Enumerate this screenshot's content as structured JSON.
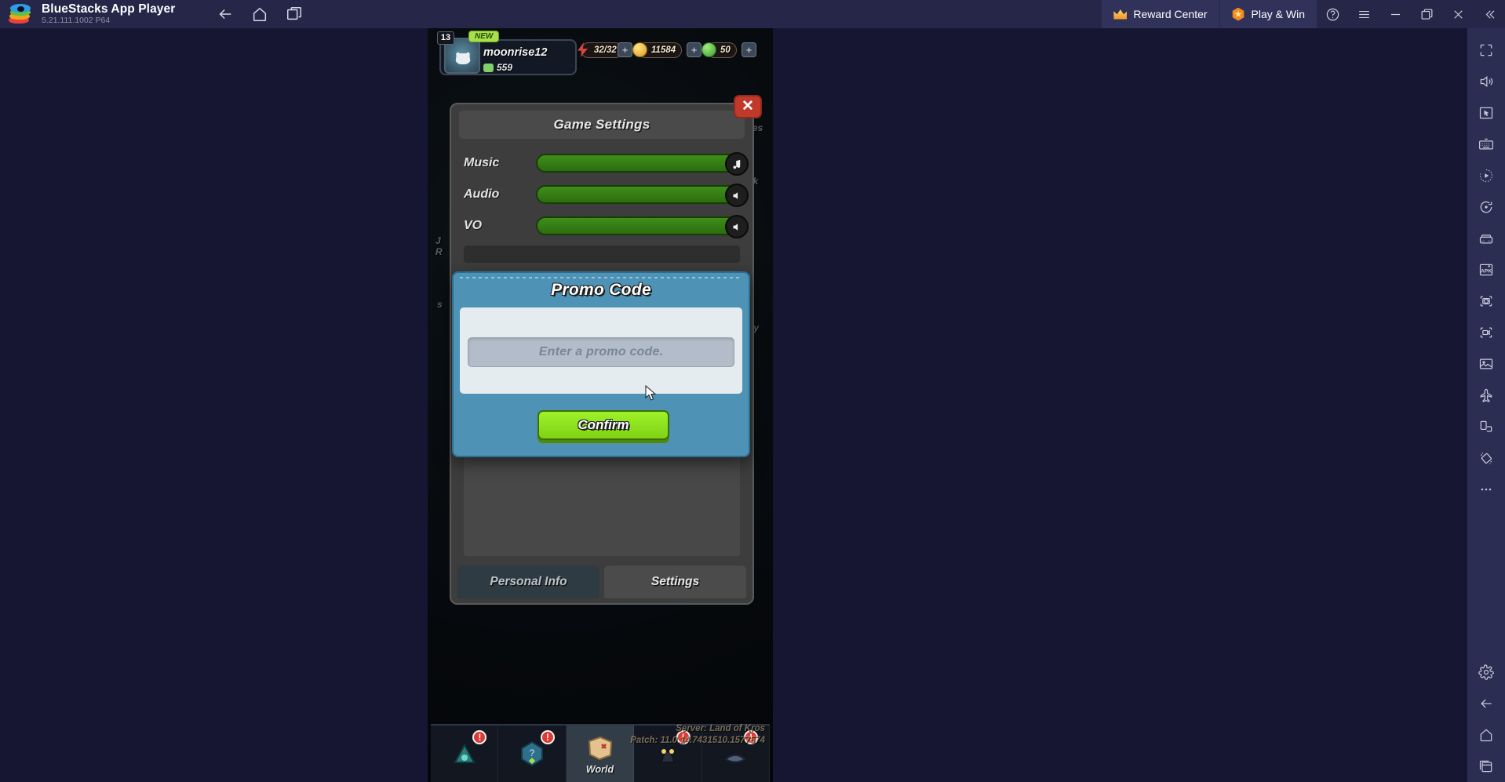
{
  "titlebar": {
    "app_name": "BlueStacks App Player",
    "version": "5.21.111.1002  P64",
    "logo_icon": "bluestacks-logo",
    "nav": [
      {
        "name": "back",
        "icon": "arrow-left-icon"
      },
      {
        "name": "home",
        "icon": "home-icon"
      },
      {
        "name": "multi-instance",
        "icon": "window-stack-icon"
      }
    ],
    "reward_center": {
      "label": "Reward Center",
      "icon": "crown-icon"
    },
    "play_and_win": {
      "label": "Play & Win",
      "icon": "hex-star-icon"
    },
    "window_buttons": [
      {
        "name": "help",
        "icon": "question-circle-icon"
      },
      {
        "name": "menu",
        "icon": "hamburger-icon"
      },
      {
        "name": "minimize",
        "icon": "minimize-icon"
      },
      {
        "name": "maximize",
        "icon": "restore-icon"
      },
      {
        "name": "close",
        "icon": "close-icon"
      },
      {
        "name": "collapse-sidebar",
        "icon": "chevron-double-left-icon"
      }
    ]
  },
  "sidebar": {
    "icons": [
      "fullscreen-icon",
      "volume-icon",
      "cursor-pointer-icon",
      "keyboard-icon",
      "macro-play-icon",
      "rotate-icon",
      "gamepad-icon",
      "apk-install-icon",
      "screenshot-icon",
      "screen-record-icon",
      "gallery-icon",
      "eco-mode-icon",
      "screen-rotate-icon",
      "shake-icon",
      "more-options-icon",
      "gear-icon",
      "back-arrow-icon",
      "home-icon",
      "recents-icon"
    ]
  },
  "game": {
    "hud": {
      "level": "13",
      "new_badge": "NEW",
      "player_name": "moonrise12",
      "secondary_count": "559",
      "energy": "32/32",
      "gold": "11584",
      "gems": "50",
      "plus_label": "+"
    },
    "settings_panel": {
      "close_label": "✕",
      "title": "Game Settings",
      "sliders": [
        {
          "label": "Music",
          "icon": "music-note-icon",
          "value": 100
        },
        {
          "label": "Audio",
          "icon": "speaker-icon",
          "value": 100
        },
        {
          "label": "VO",
          "icon": "speaker-icon",
          "value": 100
        }
      ],
      "tabs": [
        {
          "label": "Personal Info",
          "active": false
        },
        {
          "label": "Settings",
          "active": true
        }
      ]
    },
    "background_labels": {
      "cookies": "kies",
      "back": "ck",
      "join": "J",
      "r": "R",
      "s_small": "s",
      "ity": "ity"
    },
    "bottom_nav": {
      "items": [
        {
          "name": "nav-item-bag",
          "icon": "bag-icon",
          "label": "",
          "alert": "!"
        },
        {
          "name": "nav-item-gacha",
          "icon": "gem-icon",
          "label": "",
          "alert": "!"
        },
        {
          "name": "nav-item-world",
          "icon": "map-icon",
          "label": "World",
          "alert": ""
        },
        {
          "name": "nav-item-heroes",
          "icon": "heroes-icon",
          "label": "",
          "alert": "!"
        },
        {
          "name": "nav-item-shop",
          "icon": "shop-icon",
          "label": "",
          "alert": "!"
        }
      ],
      "server_line": "Server: Land of Kros",
      "patch_line": "Patch: 11.0.14.7431510.1577574"
    }
  },
  "promo_modal": {
    "title": "Promo Code",
    "input_placeholder": "Enter a promo code.",
    "input_value": "",
    "confirm_label": "Confirm"
  },
  "colors": {
    "titlebar_bg": "#262748",
    "sidebar_bg": "#2b2d52",
    "accent_orange": "#f08a1e",
    "modal_blue": "#4e93b6",
    "confirm_green": "#9ef229",
    "slider_green": "#3f8e1b",
    "close_red": "#c0392b"
  }
}
